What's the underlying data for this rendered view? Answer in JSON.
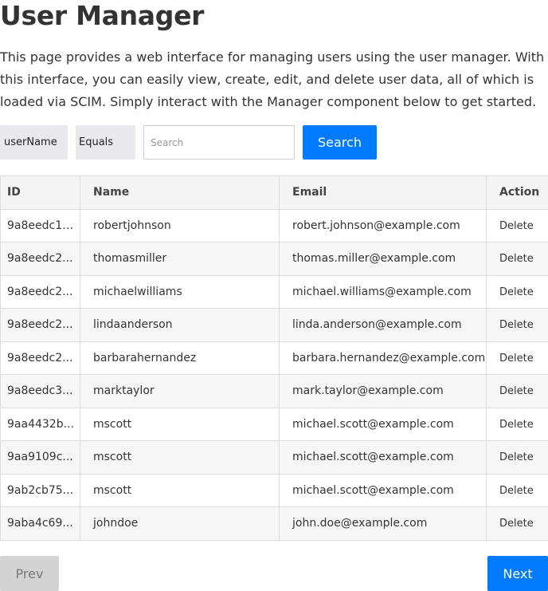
{
  "page": {
    "title": "User Manager",
    "intro": "This page provides a web interface for managing users using the user manager. With this interface, you can easily view, create, edit, and delete user data, all of which is loaded via SCIM. Simply interact with the Manager component below to get started."
  },
  "filters": {
    "attribute": "userName",
    "operator": "Equals",
    "search_value": "",
    "search_placeholder": "Search",
    "search_button": "Search"
  },
  "table": {
    "columns": [
      "ID",
      "Name",
      "Email",
      "Action"
    ],
    "rows": [
      {
        "id": "9a8eedc1-...",
        "name": "robertjohnson",
        "email": "robert.johnson@example.com",
        "action": "Delete"
      },
      {
        "id": "9a8eedc2...",
        "name": "thomasmiller",
        "email": "thomas.miller@example.com",
        "action": "Delete"
      },
      {
        "id": "9a8eedc2...",
        "name": "michaelwilliams",
        "email": "michael.williams@example.com",
        "action": "Delete"
      },
      {
        "id": "9a8eedc2...",
        "name": "lindaanderson",
        "email": "linda.anderson@example.com",
        "action": "Delete"
      },
      {
        "id": "9a8eedc2...",
        "name": "barbarahernandez",
        "email": "barbara.hernandez@example.com",
        "action": "Delete"
      },
      {
        "id": "9a8eedc3...",
        "name": "marktaylor",
        "email": "mark.taylor@example.com",
        "action": "Delete"
      },
      {
        "id": "9aa4432b...",
        "name": "mscott",
        "email": "michael.scott@example.com",
        "action": "Delete"
      },
      {
        "id": "9aa9109c...",
        "name": "mscott",
        "email": "michael.scott@example.com",
        "action": "Delete"
      },
      {
        "id": "9ab2cb75...",
        "name": "mscott",
        "email": "michael.scott@example.com",
        "action": "Delete"
      },
      {
        "id": "9aba4c69...",
        "name": "johndoe",
        "email": "john.doe@example.com",
        "action": "Delete"
      }
    ]
  },
  "pager": {
    "prev": "Prev",
    "next": "Next"
  },
  "colors": {
    "primary": "#007bff",
    "disabled": "#d3d3d3"
  }
}
